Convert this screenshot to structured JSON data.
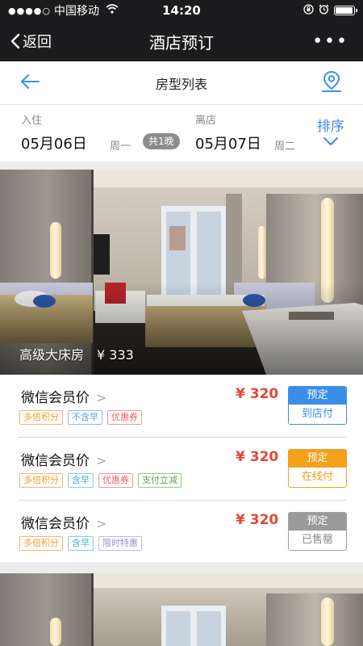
{
  "status_bar": {
    "signal": "●●●●○",
    "carrier": "中国移动",
    "time": "14:20",
    "battery_level": 0.95
  },
  "nav": {
    "back_label": "返回",
    "title": "酒店预订",
    "more_label": "•••"
  },
  "subheader": {
    "title": "房型列表"
  },
  "stay": {
    "checkin_label": "入住",
    "checkin_date": "05月06日",
    "checkin_weekday": "周一",
    "nights": "共1晚",
    "checkout_label": "离店",
    "checkout_date": "05月07日",
    "checkout_weekday": "周二",
    "sort_label": "排序"
  },
  "room": {
    "name": "高级大床房",
    "price": "¥ 333"
  },
  "rates": [
    {
      "name": "微信会员价",
      "price": "¥ 320",
      "tags": [
        {
          "text": "多倍积分",
          "color": "orange"
        },
        {
          "text": "不含早",
          "color": "blue"
        },
        {
          "text": "优惠券",
          "color": "red"
        }
      ],
      "book_top": "预定",
      "book_bottom": "到店付",
      "book_style": "blue"
    },
    {
      "name": "微信会员价",
      "price": "¥ 320",
      "tags": [
        {
          "text": "多倍积分",
          "color": "orange"
        },
        {
          "text": "含早",
          "color": "teal"
        },
        {
          "text": "优惠券",
          "color": "red"
        },
        {
          "text": "支付立减",
          "color": "green"
        }
      ],
      "book_top": "预定",
      "book_bottom": "在线付",
      "book_style": "orange"
    },
    {
      "name": "微信会员价",
      "price": "¥ 320",
      "tags": [
        {
          "text": "多倍积分",
          "color": "orange"
        },
        {
          "text": "含早",
          "color": "teal"
        },
        {
          "text": "限时特惠",
          "color": "purple"
        }
      ],
      "book_top": "预定",
      "book_bottom": "已售罄",
      "book_style": "gray"
    }
  ],
  "colors": {
    "accent_blue": "#3b8ee8",
    "price_red": "#e8443a",
    "book_orange": "#f3a01b",
    "navbar": "#1c1c1e"
  }
}
